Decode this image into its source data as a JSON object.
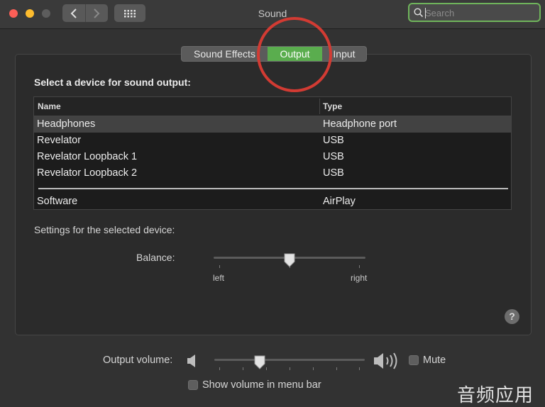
{
  "window": {
    "title": "Sound"
  },
  "toolbar": {
    "back_icon": "chevron-left-icon",
    "forward_icon": "chevron-right-icon",
    "show_all_icon": "grid-icon"
  },
  "search": {
    "placeholder": "Search",
    "value": ""
  },
  "tabs": [
    {
      "label": "Sound Effects"
    },
    {
      "label": "Output",
      "selected": true
    },
    {
      "label": "Input"
    }
  ],
  "output": {
    "heading": "Select a device for sound output:",
    "columns": {
      "name": "Name",
      "type": "Type"
    },
    "devices": [
      {
        "name": "Headphones",
        "type": "Headphone port",
        "selected": true
      },
      {
        "name": "Revelator",
        "type": "USB"
      },
      {
        "name": "Revelator Loopback 1",
        "type": "USB"
      },
      {
        "name": "Revelator Loopback 2",
        "type": "USB"
      },
      {
        "name": "Software",
        "type": "AirPlay"
      }
    ],
    "settings_heading": "Settings for the selected device:",
    "balance": {
      "label": "Balance:",
      "left": "left",
      "right": "right",
      "value": 0.5
    }
  },
  "footer": {
    "output_volume_label": "Output volume:",
    "volume_value": 0.3,
    "mute_label": "Mute",
    "mute_checked": false,
    "menu_bar_label": "Show volume in menu bar",
    "menu_bar_checked": false
  },
  "watermark": "音频应用",
  "colors": {
    "accent": "#5aad4e",
    "annotation": "#d23b33",
    "search_focus": "#6fb45b"
  }
}
